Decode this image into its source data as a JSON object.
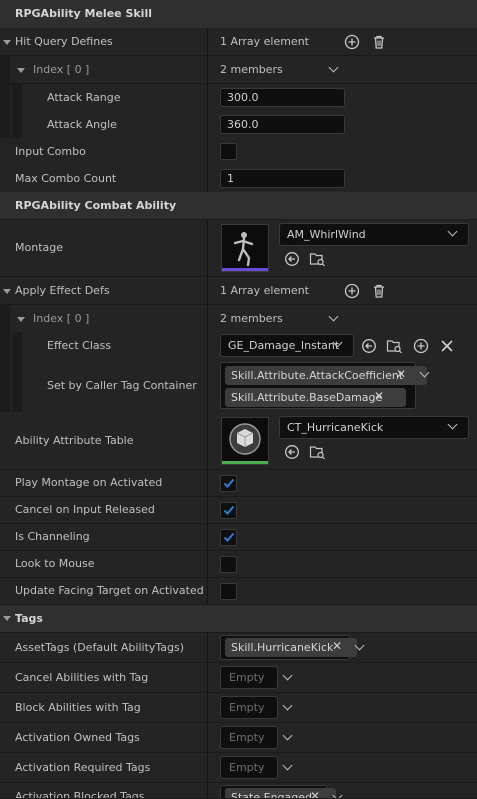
{
  "melee": {
    "header": "RPGAbility Melee Skill",
    "hit_query": {
      "label": "Hit Query Defines",
      "value": "1 Array element"
    },
    "index": {
      "label": "Index [ 0 ]",
      "value": "2 members"
    },
    "attack_range": {
      "label": "Attack Range",
      "value": "300.0"
    },
    "attack_angle": {
      "label": "Attack Angle",
      "value": "360.0"
    },
    "input_combo": {
      "label": "Input Combo",
      "checked": false
    },
    "max_combo": {
      "label": "Max Combo Count",
      "value": "1"
    }
  },
  "combat": {
    "header": "RPGAbility Combat Ability",
    "montage": {
      "label": "Montage",
      "value": "AM_WhirlWind"
    },
    "apply_effect": {
      "label": "Apply Effect Defs",
      "value": "1 Array element"
    },
    "index": {
      "label": "Index [ 0 ]",
      "value": "2 members"
    },
    "effect_class": {
      "label": "Effect Class",
      "value": "GE_Damage_Instant"
    },
    "set_by_caller": {
      "label": "Set by Caller Tag Container",
      "tags": [
        "Skill.Attribute.AttackCoefficient",
        "Skill.Attribute.BaseDamage"
      ]
    },
    "attr_table": {
      "label": "Ability Attribute Table",
      "value": "CT_HurricaneKick"
    },
    "play_montage": {
      "label": "Play Montage on Activated",
      "checked": true
    },
    "cancel_input": {
      "label": "Cancel on Input Released",
      "checked": true
    },
    "is_channeling": {
      "label": "Is Channeling",
      "checked": true
    },
    "look_mouse": {
      "label": "Look to Mouse",
      "checked": false
    },
    "update_facing": {
      "label": "Update Facing Target on Activated",
      "checked": false
    }
  },
  "tags": {
    "header": "Tags",
    "asset_tags": {
      "label": "AssetTags (Default AbilityTags)",
      "tag": "Skill.HurricaneKick"
    },
    "cancel_abilities": {
      "label": "Cancel Abilities with Tag",
      "value": "Empty"
    },
    "block_abilities": {
      "label": "Block Abilities with Tag",
      "value": "Empty"
    },
    "activation_owned": {
      "label": "Activation Owned Tags",
      "value": "Empty"
    },
    "activation_required": {
      "label": "Activation Required Tags",
      "value": "Empty"
    },
    "activation_blocked": {
      "label": "Activation Blocked Tags",
      "tag": "State.Engaged"
    }
  },
  "colors": {
    "accent": "#2f7fd6",
    "panel": "#242424",
    "header": "#2f2f2f",
    "field": "#0f0f0f"
  }
}
